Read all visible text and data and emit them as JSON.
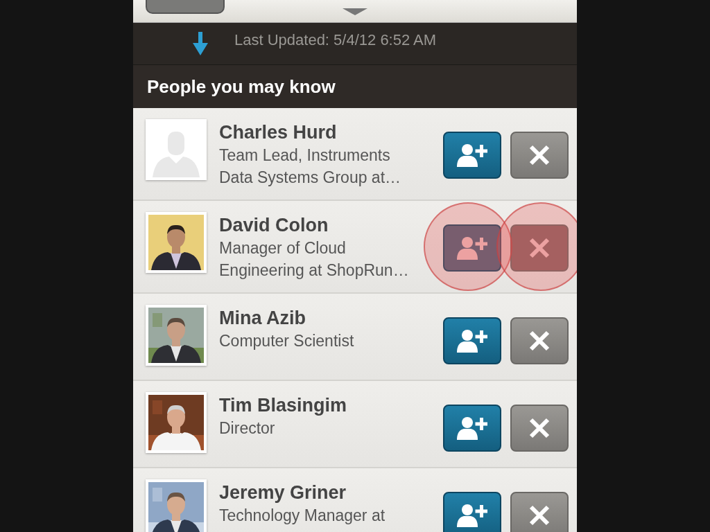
{
  "refresh": {
    "text": "Last Updated: 5/4/12 6:52 AM"
  },
  "section_title": "People you may know",
  "people": [
    {
      "name": "Charles Hurd",
      "headline_lines": [
        "Team Lead, Instruments",
        "Data Systems Group at…"
      ],
      "avatar": {
        "kind": "placeholder"
      },
      "pressed": false
    },
    {
      "name": "David Colon",
      "headline_lines": [
        "Manager of Cloud",
        "Engineering at ShopRun…"
      ],
      "avatar": {
        "kind": "picture"
      },
      "pressed": true
    },
    {
      "name": "Mina Azib",
      "headline_lines": [
        "Computer Scientist"
      ],
      "avatar": {
        "kind": "picture"
      },
      "pressed": false
    },
    {
      "name": "Tim Blasingim",
      "headline_lines": [
        "Director"
      ],
      "avatar": {
        "kind": "picture"
      },
      "pressed": false
    },
    {
      "name": "Jeremy Griner",
      "headline_lines": [
        "Technology Manager at"
      ],
      "avatar": {
        "kind": "picture"
      },
      "pressed": false
    }
  ]
}
